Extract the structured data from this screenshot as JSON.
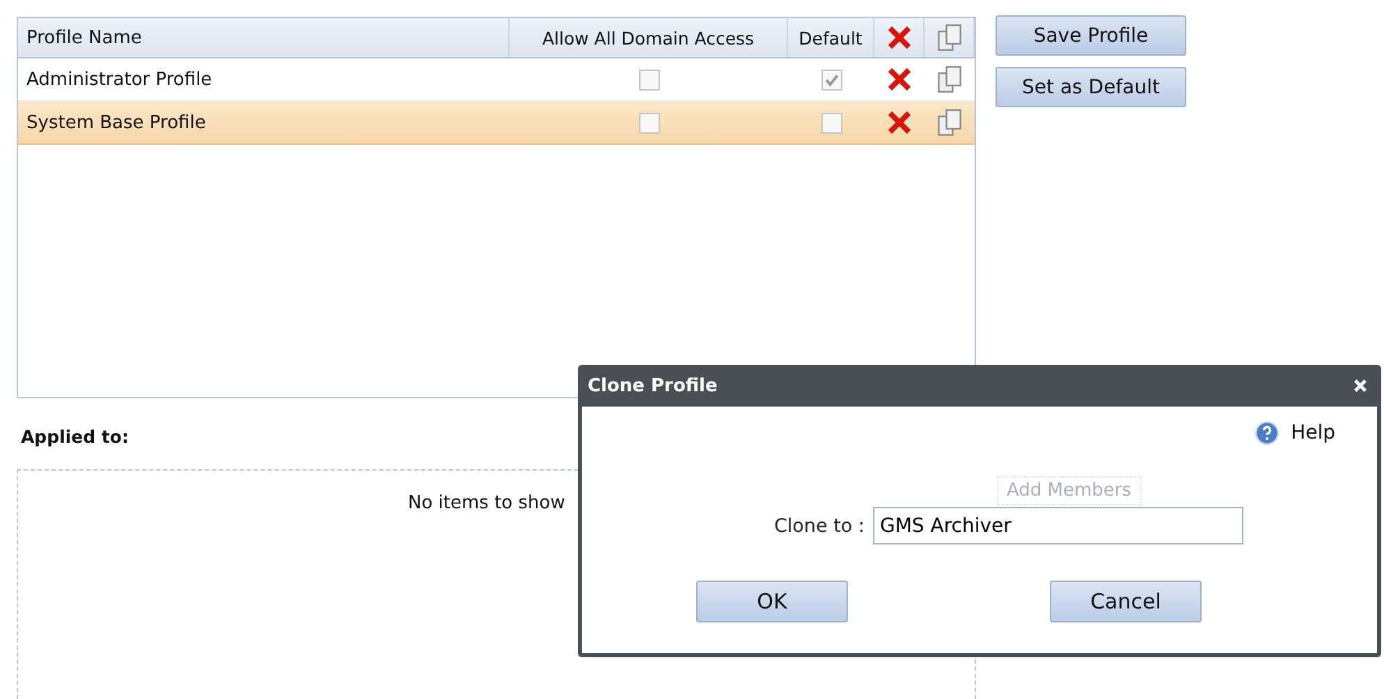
{
  "table": {
    "columns": [
      "Profile Name",
      "Allow All Domain Access",
      "Default"
    ],
    "rows": [
      {
        "name": "Administrator Profile",
        "allow_all_domain_access": false,
        "default": true,
        "selected": false
      },
      {
        "name": "System Base Profile",
        "allow_all_domain_access": false,
        "default": false,
        "selected": true
      }
    ]
  },
  "buttons": [
    "Save Profile",
    "Set as Default"
  ],
  "applied_to": {
    "label": "Applied to:",
    "empty_text": "No items to show",
    "add_button": "Add Members"
  },
  "dialog": {
    "title": "Clone Profile",
    "help": "Help",
    "field_label": "Clone to :",
    "field_value": "GMS Archiver",
    "buttons": [
      "OK",
      "Cancel"
    ]
  }
}
